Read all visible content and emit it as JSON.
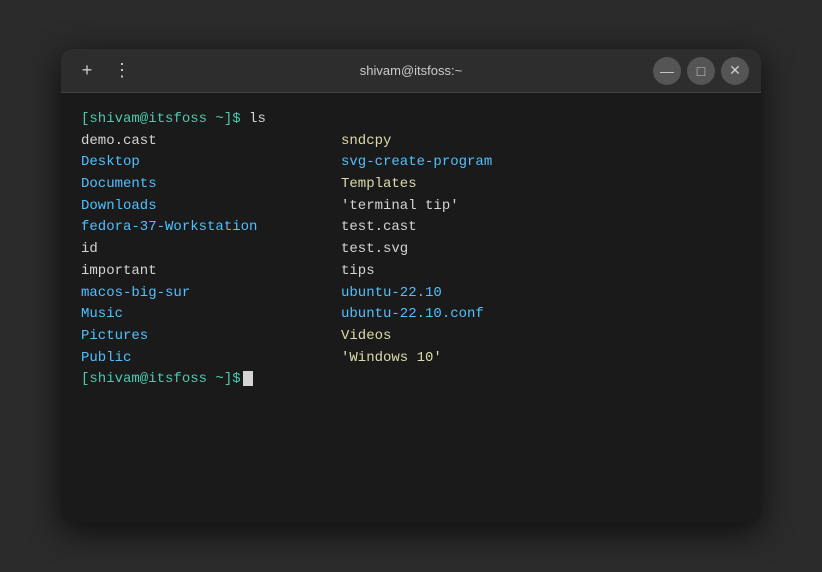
{
  "window": {
    "title": "shivam@itsfoss:~",
    "controls": {
      "plus": "+",
      "dots": "⋮",
      "minimize": "—",
      "maximize": "□",
      "close": "✕"
    }
  },
  "terminal": {
    "prompt_prefix": "[shivam@itsfoss ~]$",
    "command": " ls",
    "left_col": [
      {
        "text": "demo.cast",
        "color": "white"
      },
      {
        "text": "Desktop",
        "color": "cyan"
      },
      {
        "text": "Documents",
        "color": "cyan"
      },
      {
        "text": "Downloads",
        "color": "cyan"
      },
      {
        "text": "fedora-37-Workstation",
        "color": "cyan"
      },
      {
        "text": "id",
        "color": "white"
      },
      {
        "text": "important",
        "color": "white"
      },
      {
        "text": "macos-big-sur",
        "color": "cyan"
      },
      {
        "text": "Music",
        "color": "cyan"
      },
      {
        "text": "Pictures",
        "color": "cyan"
      },
      {
        "text": "Public",
        "color": "cyan"
      }
    ],
    "right_col": [
      {
        "text": "sndcpy",
        "color": "yellow"
      },
      {
        "text": "svg-create-program",
        "color": "cyan"
      },
      {
        "text": "Templates",
        "color": "yellow"
      },
      {
        "text": "'terminal tip'",
        "color": "white"
      },
      {
        "text": "test.cast",
        "color": "white"
      },
      {
        "text": "test.svg",
        "color": "white"
      },
      {
        "text": "tips",
        "color": "white"
      },
      {
        "text": "ubuntu-22.10",
        "color": "cyan"
      },
      {
        "text": "ubuntu-22.10.conf",
        "color": "cyan"
      },
      {
        "text": "Videos",
        "color": "yellow"
      },
      {
        "text": "'Windows 10'",
        "color": "yellow"
      }
    ],
    "prompt2_prefix": "[shivam@itsfoss ~]$"
  }
}
